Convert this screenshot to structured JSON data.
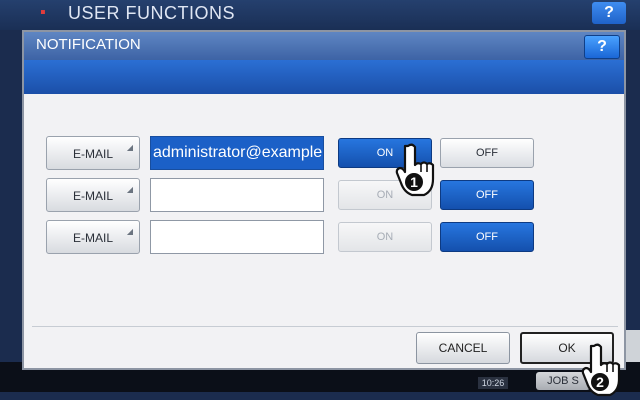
{
  "background": {
    "title": "USER FUNCTIONS",
    "help_label": "?",
    "footer_time": "10:26",
    "footer_button_label": "JOB S"
  },
  "dialog": {
    "title": "NOTIFICATION",
    "help_label": "?",
    "rows": [
      {
        "button_label": "E-MAIL",
        "address": "administrator@example.c",
        "on_label": "ON",
        "off_label": "OFF",
        "state": "on"
      },
      {
        "button_label": "E-MAIL",
        "address": "",
        "on_label": "ON",
        "off_label": "OFF",
        "state": "off"
      },
      {
        "button_label": "E-MAIL",
        "address": "",
        "on_label": "ON",
        "off_label": "OFF",
        "state": "off"
      }
    ],
    "cancel_label": "CANCEL",
    "ok_label": "OK"
  },
  "callouts": [
    {
      "number": "1",
      "icon": "hand-pointer-icon"
    },
    {
      "number": "2",
      "icon": "hand-pointer-icon"
    }
  ],
  "colors": {
    "title_bar": "#4f76b8",
    "band": "#2463c2",
    "selected": "#1b60c7",
    "dialog_bg": "#f2f2f4"
  }
}
